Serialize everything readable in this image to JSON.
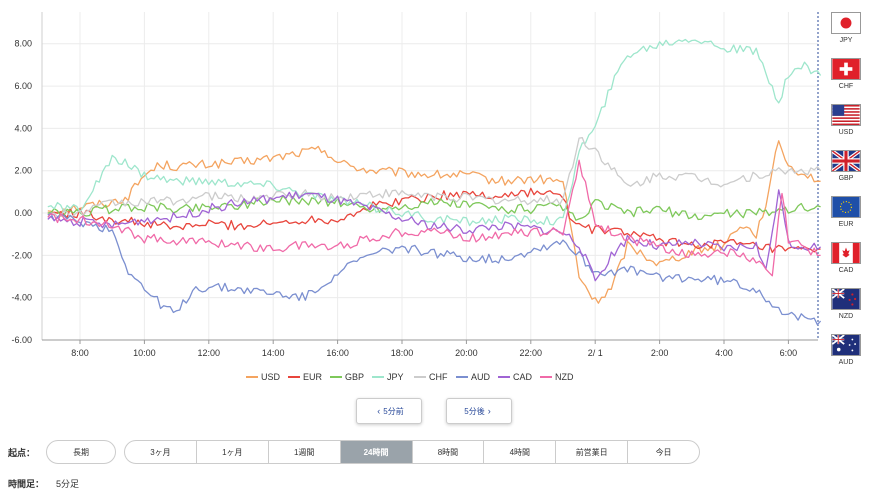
{
  "chart_data": {
    "type": "line",
    "x_ticks": [
      "8:00",
      "10:00",
      "12:00",
      "14:00",
      "16:00",
      "18:00",
      "20:00",
      "22:00",
      "2/ 1",
      "2:00",
      "4:00",
      "6:00"
    ],
    "y_ticks": [
      "8.00",
      "6.00",
      "4.00",
      "2.00",
      "0.00",
      "-2.00",
      "-4.00",
      "-6.00"
    ],
    "ylim": [
      -6,
      9.5
    ],
    "x_range": [
      "7:00",
      "6:55"
    ],
    "grid": true,
    "legend_position": "bottom",
    "series": [
      {
        "name": "USD",
        "color": "#f4a460",
        "points": [
          [
            0,
            0.1
          ],
          [
            1,
            0.3
          ],
          [
            2,
            0.5
          ],
          [
            2.5,
            0.8
          ],
          [
            3,
            1.8
          ],
          [
            3.5,
            2.3
          ],
          [
            4,
            2.2
          ],
          [
            5,
            2.3
          ],
          [
            6,
            2.4
          ],
          [
            7,
            2.6
          ],
          [
            8,
            2.9
          ],
          [
            8.6,
            3.0
          ],
          [
            9,
            2.4
          ],
          [
            10,
            2.0
          ],
          [
            11,
            1.9
          ],
          [
            12,
            1.8
          ],
          [
            13,
            1.8
          ],
          [
            14,
            1.5
          ],
          [
            15,
            1.6
          ],
          [
            16,
            1.5
          ],
          [
            16.5,
            -3.0
          ],
          [
            17,
            -4.2
          ],
          [
            17.5,
            -3.6
          ],
          [
            18,
            -1.5
          ],
          [
            19,
            -2.4
          ],
          [
            20,
            -1.8
          ],
          [
            21,
            -1.5
          ],
          [
            21.5,
            -0.5
          ],
          [
            22,
            -1.0
          ],
          [
            22.4,
            1.0
          ],
          [
            22.7,
            3.5
          ],
          [
            23,
            2.2
          ],
          [
            23.6,
            1.8
          ],
          [
            24,
            1.5
          ]
        ]
      },
      {
        "name": "EUR",
        "color": "#e8453c",
        "points": [
          [
            0,
            0.0
          ],
          [
            1,
            0.0
          ],
          [
            2,
            -0.3
          ],
          [
            3,
            -0.5
          ],
          [
            4,
            -0.7
          ],
          [
            5,
            -0.5
          ],
          [
            6,
            -0.6
          ],
          [
            7,
            -0.5
          ],
          [
            8,
            -0.3
          ],
          [
            9,
            -0.3
          ],
          [
            10,
            0.3
          ],
          [
            11,
            0.6
          ],
          [
            12,
            0.8
          ],
          [
            13,
            0.9
          ],
          [
            14,
            0.8
          ],
          [
            15,
            1.0
          ],
          [
            16,
            0.8
          ],
          [
            16.3,
            -0.5
          ],
          [
            17,
            -0.8
          ],
          [
            18,
            -0.9
          ],
          [
            19,
            -1.3
          ],
          [
            20,
            -1.5
          ],
          [
            21,
            -1.4
          ],
          [
            22,
            -1.6
          ],
          [
            23,
            -1.8
          ],
          [
            24,
            -1.7
          ]
        ]
      },
      {
        "name": "GBP",
        "color": "#7ec85a",
        "points": [
          [
            0,
            0.0
          ],
          [
            1,
            0.0
          ],
          [
            2,
            0.2
          ],
          [
            3,
            0.3
          ],
          [
            4,
            0.2
          ],
          [
            5,
            0.3
          ],
          [
            6,
            0.4
          ],
          [
            7,
            0.6
          ],
          [
            8,
            0.6
          ],
          [
            9,
            0.5
          ],
          [
            10,
            0.2
          ],
          [
            11,
            0.3
          ],
          [
            12,
            0.5
          ],
          [
            13,
            0.4
          ],
          [
            14,
            0.2
          ],
          [
            15,
            0.2
          ],
          [
            16,
            0.3
          ],
          [
            16.5,
            -0.5
          ],
          [
            17,
            0.5
          ],
          [
            18,
            0.0
          ],
          [
            19,
            0.2
          ],
          [
            20,
            -0.2
          ],
          [
            21,
            0.0
          ],
          [
            22,
            0.0
          ],
          [
            23,
            0.2
          ],
          [
            24,
            0.3
          ]
        ]
      },
      {
        "name": "JPY",
        "color": "#9ee6cc",
        "points": [
          [
            0,
            0.3
          ],
          [
            1,
            0.2
          ],
          [
            2,
            2.5
          ],
          [
            2.5,
            2.3
          ],
          [
            3,
            1.8
          ],
          [
            4,
            1.5
          ],
          [
            5,
            1.5
          ],
          [
            6,
            1.4
          ],
          [
            7,
            1.3
          ],
          [
            8,
            0.9
          ],
          [
            9,
            0.6
          ],
          [
            10,
            0.3
          ],
          [
            11,
            0.0
          ],
          [
            12,
            -0.3
          ],
          [
            13,
            -0.4
          ],
          [
            14,
            -0.3
          ],
          [
            15,
            -0.3
          ],
          [
            16,
            -0.4
          ],
          [
            16.5,
            3.0
          ],
          [
            17,
            4.0
          ],
          [
            17.5,
            6.0
          ],
          [
            18,
            7.5
          ],
          [
            19,
            8.0
          ],
          [
            20,
            8.3
          ],
          [
            21,
            7.8
          ],
          [
            22,
            7.6
          ],
          [
            22.7,
            5.3
          ],
          [
            23,
            6.5
          ],
          [
            23.5,
            7.0
          ],
          [
            24,
            6.5
          ]
        ]
      },
      {
        "name": "CHF",
        "color": "#cccccc",
        "points": [
          [
            0,
            -0.1
          ],
          [
            1,
            0.0
          ],
          [
            2,
            0.5
          ],
          [
            3,
            0.5
          ],
          [
            4,
            0.6
          ],
          [
            5,
            0.8
          ],
          [
            6,
            0.7
          ],
          [
            7,
            0.8
          ],
          [
            8,
            0.9
          ],
          [
            9,
            0.7
          ],
          [
            10,
            0.9
          ],
          [
            11,
            0.9
          ],
          [
            12,
            0.8
          ],
          [
            13,
            0.7
          ],
          [
            14,
            0.6
          ],
          [
            15,
            0.6
          ],
          [
            16,
            0.6
          ],
          [
            16.5,
            3.5
          ],
          [
            17,
            3.0
          ],
          [
            18,
            1.2
          ],
          [
            19,
            1.8
          ],
          [
            20,
            1.7
          ],
          [
            21,
            1.4
          ],
          [
            22,
            1.8
          ],
          [
            23,
            2.0
          ],
          [
            24,
            2.0
          ]
        ]
      },
      {
        "name": "AUD",
        "color": "#7b8fd0",
        "points": [
          [
            0,
            -0.1
          ],
          [
            1,
            -0.4
          ],
          [
            2,
            -0.8
          ],
          [
            2.5,
            -2.7
          ],
          [
            3,
            -3.6
          ],
          [
            3.5,
            -4.3
          ],
          [
            4,
            -4.8
          ],
          [
            4.5,
            -3.6
          ],
          [
            5,
            -3.5
          ],
          [
            6,
            -3.6
          ],
          [
            7,
            -3.8
          ],
          [
            8,
            -4.0
          ],
          [
            9,
            -2.8
          ],
          [
            10,
            -2.0
          ],
          [
            11,
            -1.6
          ],
          [
            12,
            -1.9
          ],
          [
            13,
            -2.1
          ],
          [
            14,
            -2.2
          ],
          [
            15,
            -1.8
          ],
          [
            16,
            -1.3
          ],
          [
            16.5,
            -2.0
          ],
          [
            17,
            -2.8
          ],
          [
            18,
            -2.7
          ],
          [
            19,
            -3.0
          ],
          [
            20,
            -3.1
          ],
          [
            21,
            -3.2
          ],
          [
            22,
            -3.6
          ],
          [
            23,
            -4.9
          ],
          [
            24,
            -5.1
          ]
        ]
      },
      {
        "name": "CAD",
        "color": "#a064d4",
        "points": [
          [
            0,
            -0.3
          ],
          [
            1,
            -0.4
          ],
          [
            2,
            -0.6
          ],
          [
            3,
            -0.3
          ],
          [
            4,
            -0.2
          ],
          [
            5,
            0.2
          ],
          [
            6,
            0.5
          ],
          [
            7,
            0.7
          ],
          [
            8,
            0.9
          ],
          [
            9,
            0.6
          ],
          [
            10,
            0.2
          ],
          [
            11,
            -0.3
          ],
          [
            12,
            -0.6
          ],
          [
            13,
            -0.8
          ],
          [
            14,
            -0.6
          ],
          [
            15,
            -0.7
          ],
          [
            16,
            -0.9
          ],
          [
            16.5,
            -1.5
          ],
          [
            17,
            -3.2
          ],
          [
            17.5,
            -2.0
          ],
          [
            18,
            -1.2
          ],
          [
            19,
            -1.6
          ],
          [
            20,
            -1.4
          ],
          [
            21,
            -1.7
          ],
          [
            22,
            -1.5
          ],
          [
            22.3,
            -2.8
          ],
          [
            22.7,
            1.2
          ],
          [
            23,
            -1.5
          ],
          [
            24,
            -1.6
          ]
        ]
      },
      {
        "name": "NZD",
        "color": "#f06aa8",
        "points": [
          [
            0,
            -0.2
          ],
          [
            1,
            -0.3
          ],
          [
            2,
            -0.5
          ],
          [
            3,
            -1.2
          ],
          [
            4,
            -1.3
          ],
          [
            5,
            -1.4
          ],
          [
            6,
            -1.5
          ],
          [
            7,
            -1.7
          ],
          [
            8,
            -1.5
          ],
          [
            9,
            -1.6
          ],
          [
            10,
            -1.2
          ],
          [
            11,
            -0.9
          ],
          [
            12,
            -0.8
          ],
          [
            13,
            -1.2
          ],
          [
            14,
            -1.0
          ],
          [
            15,
            -0.9
          ],
          [
            16,
            -0.9
          ],
          [
            16.5,
            2.5
          ],
          [
            17,
            -0.5
          ],
          [
            18,
            -1.2
          ],
          [
            19,
            -1.6
          ],
          [
            20,
            -2.0
          ],
          [
            21,
            -1.8
          ],
          [
            22,
            -2.3
          ],
          [
            22.5,
            -3.0
          ],
          [
            22.8,
            1.0
          ],
          [
            23,
            -1.3
          ],
          [
            24,
            -2.0
          ]
        ]
      }
    ]
  },
  "currency_flags": [
    {
      "code": "JPY",
      "flag": "japan-flag"
    },
    {
      "code": "CHF",
      "flag": "switzerland-flag"
    },
    {
      "code": "USD",
      "flag": "usa-flag"
    },
    {
      "code": "GBP",
      "flag": "uk-flag"
    },
    {
      "code": "EUR",
      "flag": "eu-flag"
    },
    {
      "code": "CAD",
      "flag": "canada-flag"
    },
    {
      "code": "NZD",
      "flag": "new-zealand-flag"
    },
    {
      "code": "AUD",
      "flag": "australia-flag"
    }
  ],
  "nav": {
    "prev_label": "5分前",
    "next_label": "5分後",
    "prev_icon": "chevron-left-icon",
    "next_icon": "chevron-right-icon"
  },
  "controls": {
    "start_label": "起点：",
    "long_label": "長期",
    "periods": [
      "3ヶ月",
      "1ヶ月",
      "1週間",
      "24時間",
      "8時間",
      "4時間",
      "前営業日",
      "今日"
    ],
    "active_period": "24時間",
    "timeframe_label": "時間足：",
    "timeframe_value": "5分足"
  }
}
